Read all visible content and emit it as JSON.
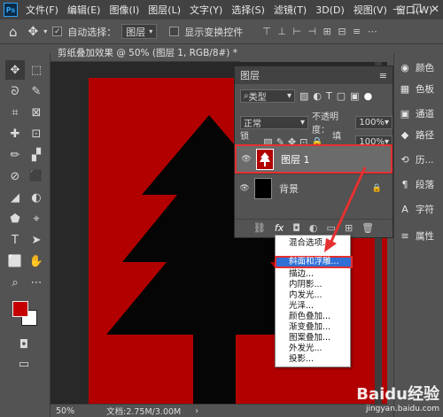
{
  "menubar": {
    "logo": "Ps",
    "items": [
      "文件(F)",
      "编辑(E)",
      "图像(I)",
      "图层(L)",
      "文字(Y)",
      "选择(S)",
      "滤镜(T)",
      "3D(D)",
      "视图(V)",
      "窗口(W)"
    ],
    "win_buttons": [
      "—",
      "❐",
      "✕"
    ]
  },
  "options": {
    "home_icon": "⌂",
    "move_icon": "✥",
    "auto_select_label": "自动选择：",
    "auto_select_value": "图层",
    "show_transform_label": "显示变换控件",
    "align_icons": "⊤ ⊥ ⊢ ⊣ ⊞ ⊟ ≡ ⋯"
  },
  "document": {
    "tab_title": "剪纸叠加效果 @ 50% (图层 1, RGB/8#) *",
    "tab_close": "×",
    "zoom": "50%",
    "doc_info": "文档:2.75M/3.00M",
    "canvas_color": "#b20000"
  },
  "tools": [
    "✥",
    "⬚",
    "ᘐ",
    "✎",
    "⌗",
    "⊠",
    "✚",
    "⊡",
    "✏",
    "▞",
    "⊘",
    "⬛",
    "◢",
    "◐",
    "⬟",
    "⌖",
    "T",
    "➤",
    "⬜",
    "✋",
    "⌕",
    "⋯"
  ],
  "colors": {
    "foreground": "#c40000",
    "background": "#ffffff"
  },
  "layers": {
    "title": "图层",
    "filter_value": "类型",
    "blend_mode": "正常",
    "opacity_label": "不透明度：",
    "opacity_value": "100%",
    "lock_label": "锁定：",
    "fill_label": "填充：",
    "fill_value": "100%",
    "rows": [
      {
        "name": "图层 1",
        "eye": "👁",
        "selected": true
      },
      {
        "name": "背景",
        "eye": "👁",
        "locked": "🔒"
      }
    ],
    "footer_icons": [
      "⛓",
      "fx",
      "◘",
      "◐",
      "▭",
      "⊞",
      "🗑"
    ]
  },
  "fx_menu": {
    "items": [
      "混合选项...",
      "斜面和浮雕...",
      "描边...",
      "内阴影...",
      "内发光...",
      "光泽...",
      "颜色叠加...",
      "渐变叠加...",
      "图案叠加...",
      "外发光...",
      "投影..."
    ],
    "highlighted": "斜面和浮雕..."
  },
  "dock": {
    "items": [
      {
        "icon": "◉",
        "label": "颜色"
      },
      {
        "icon": "▦",
        "label": "色板"
      },
      {
        "icon": "▣",
        "label": "通道"
      },
      {
        "icon": "◆",
        "label": "路径"
      },
      {
        "icon": "⟲",
        "label": "历..."
      },
      {
        "icon": "¶",
        "label": "段落"
      },
      {
        "icon": "A",
        "label": "字符"
      },
      {
        "icon": "≡",
        "label": "属性"
      }
    ]
  },
  "watermark": {
    "brand": "Baidu经验",
    "url": "jingyan.baidu.com"
  }
}
